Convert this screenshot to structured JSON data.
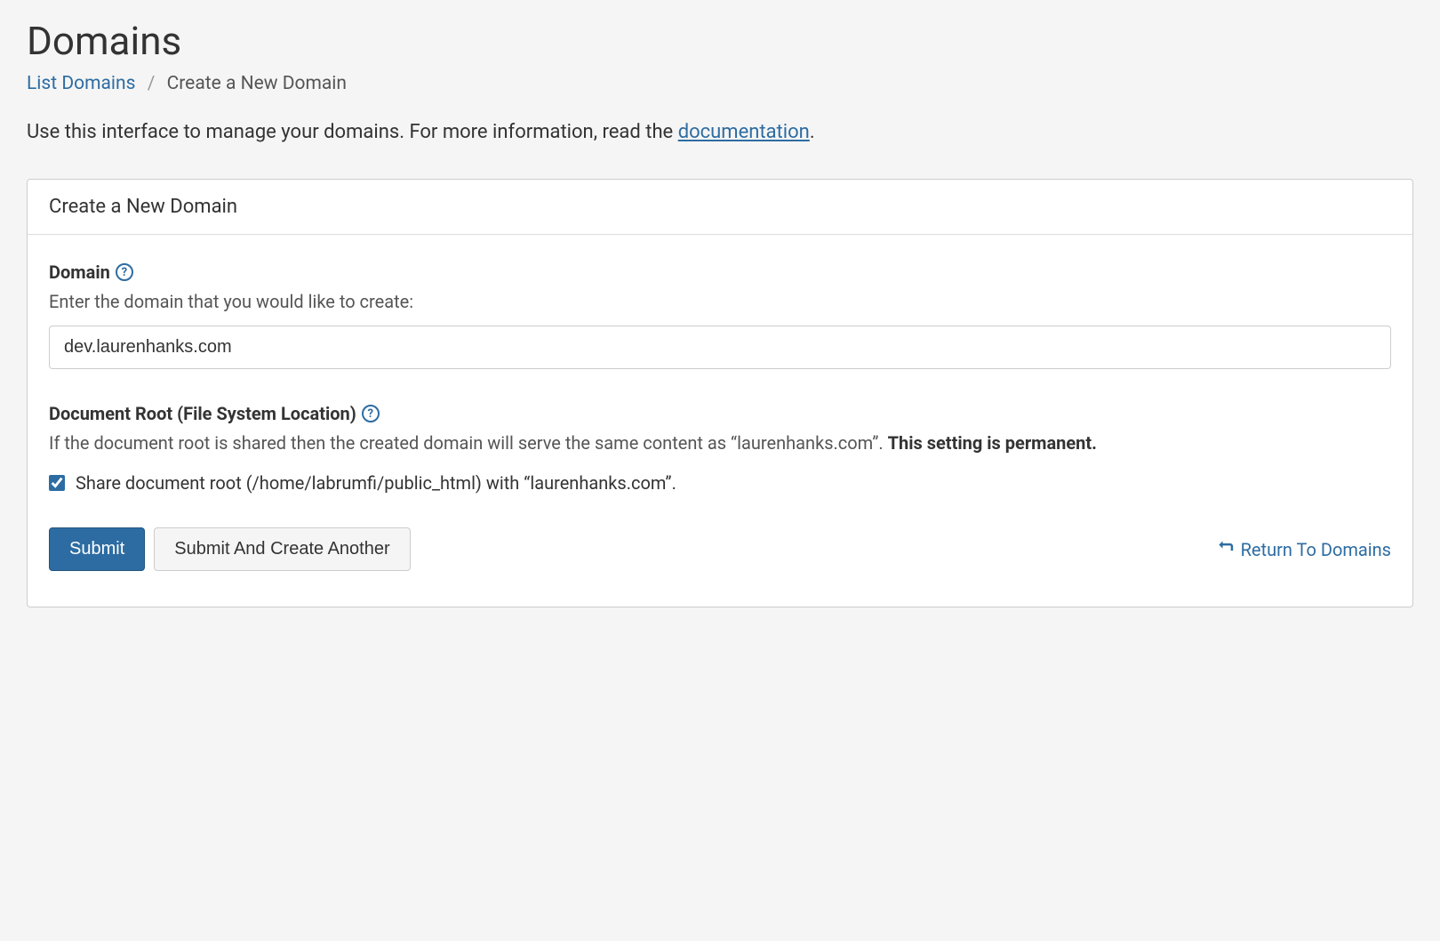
{
  "page": {
    "title": "Domains"
  },
  "breadcrumb": {
    "list_link": "List Domains",
    "current": "Create a New Domain"
  },
  "intro": {
    "text_prefix": "Use this interface to manage your domains. For more information, read the ",
    "link_text": "documentation",
    "text_suffix": "."
  },
  "panel": {
    "heading": "Create a New Domain"
  },
  "domain_field": {
    "label": "Domain",
    "hint": "Enter the domain that you would like to create:",
    "value": "dev.laurenhanks.com"
  },
  "docroot_field": {
    "label": "Document Root (File System Location)",
    "hint_prefix": "If the document root is shared then the created domain will serve the same content as “laurenhanks.com”. ",
    "hint_bold": "This setting is permanent.",
    "checkbox_label": "Share document root (/home/labrumfi/public_html) with “laurenhanks.com”."
  },
  "actions": {
    "submit": "Submit",
    "submit_another": "Submit And Create Another",
    "return_link": "Return To Domains"
  },
  "help_glyph": "?"
}
